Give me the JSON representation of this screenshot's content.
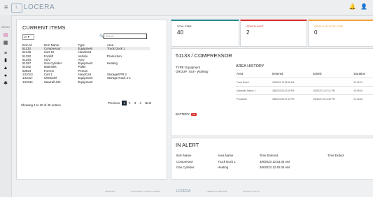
{
  "app": {
    "title": "LOCERA",
    "logo_text": "L"
  },
  "menu_label": "MENU",
  "current_items": {
    "title": "CURRENT ITEMS",
    "page_size": "10",
    "search_placeholder": "Search...",
    "columns": [
      "Item Id",
      "Item Name",
      "Type",
      "Area"
    ],
    "rows": [
      [
        "51133",
        "Compressor",
        "Equipment",
        "Truck Dock 1"
      ],
      [
        "51346",
        "Cart 10",
        "HandCart",
        ""
      ],
      [
        "51352",
        "Forklift",
        "Vehicle",
        "Production"
      ],
      [
        "51354",
        "AGV",
        "AGV",
        ""
      ],
      [
        "51357",
        "Gas Cylinder",
        "Equipment",
        "Heating"
      ],
      [
        "51362",
        "Materials",
        "Pallet",
        ""
      ],
      [
        "52864",
        "Forrest",
        "Person",
        ""
      ],
      [
        "131013",
        "Cart 1",
        "HandCart",
        "StorageEPR 2"
      ],
      [
        "131017",
        "CNModel",
        "Equipment",
        "Storage Rack 2-1"
      ],
      [
        "131644",
        "Sawzall 442",
        "Equipment",
        ""
      ]
    ],
    "entries_text": "Showing 1 to 10 of 40 entries",
    "pager": {
      "previous": "Previous",
      "pages": [
        "1",
        "2",
        "3",
        "4"
      ],
      "next": "Next"
    }
  },
  "stats": [
    {
      "title": "TOTAL ITEMS",
      "value": "40"
    },
    {
      "title": "ITEMS IN ALERT",
      "value": "2"
    },
    {
      "title": "ITEMS IN SELECTED ZONE",
      "value": "0"
    }
  ],
  "detail": {
    "title": "51133 / COMPRESSOR",
    "type_label": "TYPE:",
    "type_value": "Equipment",
    "group_label": "GROUP:",
    "group_value": "Tool - Working",
    "area_history_title": "AREA HISTORY",
    "history_columns": [
      "Area",
      "Entered",
      "Exited",
      "Duration"
    ],
    "history_rows": [
      [
        "Truck Dock 1",
        "3/9/2023 12:53:36 AM",
        "",
        "00:00:13"
      ],
      [
        "Assembly Station 1",
        "3/8/2023 06:42:15 PM",
        "3/8/2023 11:47:21 PM",
        "05:05:06"
      ],
      [
        "Production",
        "3/8/2023 08:57:44 PM",
        "3/8/2023 10:14:32 PM",
        "01:16:48"
      ]
    ],
    "battery_label": "BATTERY:",
    "battery_value": "3%"
  },
  "alerts": {
    "title": "IN ALERT",
    "columns": [
      "Item Name",
      "Area Name",
      "Time Entered",
      "Time Exited"
    ],
    "rows": [
      [
        "Compressor",
        "Truck Dock 1",
        "3/9/2023 12:53:36 AM",
        ""
      ],
      [
        "Gas Cylinder",
        "Heating",
        "3/9/2023 12:40:48 AM",
        ""
      ]
    ]
  },
  "footer": [
    "SUPPORT",
    "COPYRIGHT © 2022 LOCERA",
    "LOCERA",
    "TERMS OF SERVICE",
    "PRIVACY POLICY"
  ],
  "colors": {
    "alert_red": "#d82d2d",
    "accent_teal": "#2a8a8f",
    "accent_orange": "#f2a33a",
    "pager_dark": "#1e2a33"
  }
}
